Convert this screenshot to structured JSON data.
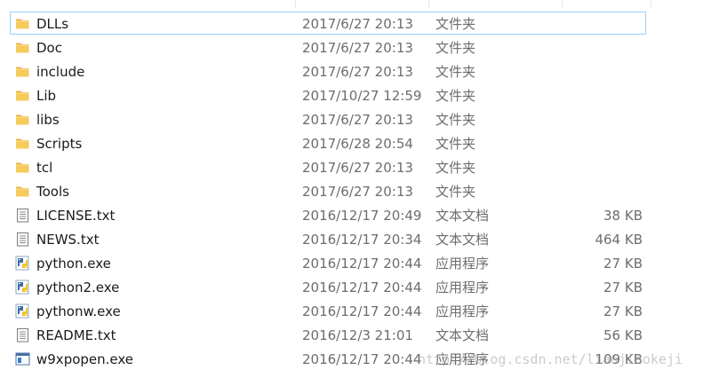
{
  "files": [
    {
      "name": "DLLs",
      "modified": "2017/6/27 20:13",
      "type": "文件夹",
      "size": "",
      "icon": "folder-icon",
      "selected": true
    },
    {
      "name": "Doc",
      "modified": "2017/6/27 20:13",
      "type": "文件夹",
      "size": "",
      "icon": "folder-icon"
    },
    {
      "name": "include",
      "modified": "2017/6/27 20:13",
      "type": "文件夹",
      "size": "",
      "icon": "folder-icon"
    },
    {
      "name": "Lib",
      "modified": "2017/10/27 12:59",
      "type": "文件夹",
      "size": "",
      "icon": "folder-icon"
    },
    {
      "name": "libs",
      "modified": "2017/6/27 20:13",
      "type": "文件夹",
      "size": "",
      "icon": "folder-icon"
    },
    {
      "name": "Scripts",
      "modified": "2017/6/28 20:54",
      "type": "文件夹",
      "size": "",
      "icon": "folder-icon"
    },
    {
      "name": "tcl",
      "modified": "2017/6/27 20:13",
      "type": "文件夹",
      "size": "",
      "icon": "folder-icon"
    },
    {
      "name": "Tools",
      "modified": "2017/6/27 20:13",
      "type": "文件夹",
      "size": "",
      "icon": "folder-icon"
    },
    {
      "name": "LICENSE.txt",
      "modified": "2016/12/17 20:49",
      "type": "文本文档",
      "size": "38 KB",
      "icon": "text-file-icon"
    },
    {
      "name": "NEWS.txt",
      "modified": "2016/12/17 20:34",
      "type": "文本文档",
      "size": "464 KB",
      "icon": "text-file-icon"
    },
    {
      "name": "python.exe",
      "modified": "2016/12/17 20:44",
      "type": "应用程序",
      "size": "27 KB",
      "icon": "python-exe-icon"
    },
    {
      "name": "python2.exe",
      "modified": "2016/12/17 20:44",
      "type": "应用程序",
      "size": "27 KB",
      "icon": "python-exe-icon"
    },
    {
      "name": "pythonw.exe",
      "modified": "2016/12/17 20:44",
      "type": "应用程序",
      "size": "27 KB",
      "icon": "python-exe-icon"
    },
    {
      "name": "README.txt",
      "modified": "2016/12/3 21:01",
      "type": "文本文档",
      "size": "56 KB",
      "icon": "text-file-icon"
    },
    {
      "name": "w9xpopen.exe",
      "modified": "2016/12/17 20:44",
      "type": "应用程序",
      "size": "109 KB",
      "icon": "application-window-icon"
    }
  ],
  "watermark": "http://blog.csdn.net/lianjiaokeji",
  "colors": {
    "selection_border": "#99d1ff",
    "folder": "#f6cb5c",
    "secondary_text": "#6d6d6d"
  }
}
